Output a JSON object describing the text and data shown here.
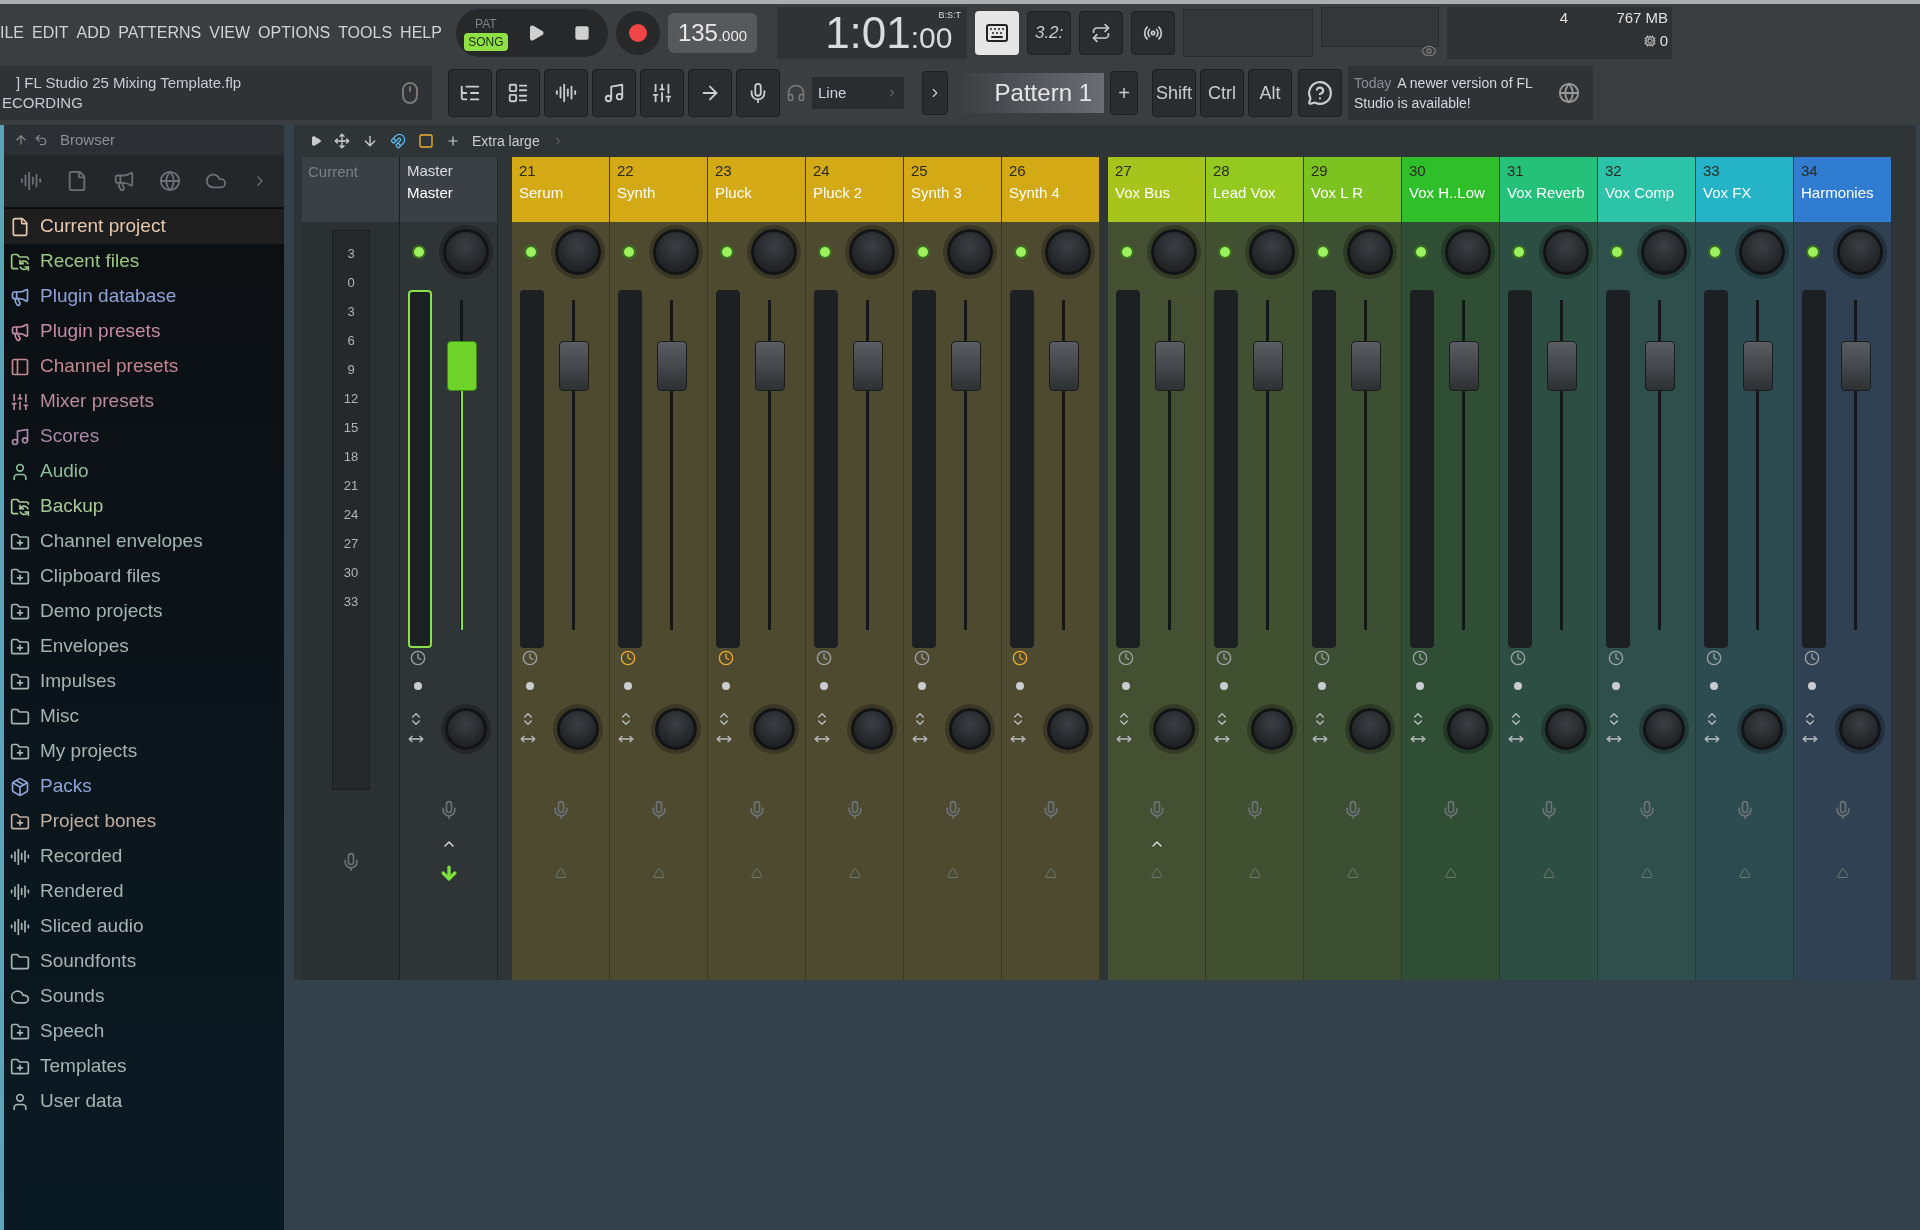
{
  "menu": [
    "ILE",
    "EDIT",
    "ADD",
    "PATTERNS",
    "VIEW",
    "OPTIONS",
    "TOOLS",
    "HELP"
  ],
  "transport": {
    "modes": [
      {
        "label": "PAT",
        "selected": false
      },
      {
        "label": "SONG",
        "selected": true
      }
    ],
    "recording": true,
    "tempo": "135",
    "tempo_fraction": ".000"
  },
  "time": {
    "main": "1:01",
    "sub": ":00",
    "format": "B:S:T"
  },
  "snap_label": "3.2:",
  "monitor": {
    "cpu": "4",
    "memory": "767 MB",
    "polyphony": "0"
  },
  "file": {
    "title": "] FL Studio 25 Mixing Template.flp",
    "status": "ECORDING"
  },
  "output": "Line",
  "pattern": {
    "name": "Pattern 1",
    "add": "+"
  },
  "modifier_keys": [
    "Shift",
    "Ctrl",
    "Alt"
  ],
  "news": {
    "when": "Today",
    "message": "A newer version of FL Studio is available!"
  },
  "browser": {
    "title": "Browser",
    "items": [
      {
        "label": "Current project",
        "kind": "file",
        "color": "#e6c8ae",
        "selected": true
      },
      {
        "label": "Recent files",
        "kind": "sync",
        "color": "#9cc685",
        "selected": false
      },
      {
        "label": "Plugin database",
        "kind": "plugin",
        "color": "#8ea4d8",
        "selected": false
      },
      {
        "label": "Plugin presets",
        "kind": "plugin",
        "color": "#c489a6",
        "selected": false
      },
      {
        "label": "Channel presets",
        "kind": "channel",
        "color": "#c48690",
        "selected": false
      },
      {
        "label": "Mixer presets",
        "kind": "mixer",
        "color": "#b98aa0",
        "selected": false
      },
      {
        "label": "Scores",
        "kind": "note",
        "color": "#a98aa8",
        "selected": false
      },
      {
        "label": "Audio",
        "kind": "user",
        "color": "#8fbc9a",
        "selected": false
      },
      {
        "label": "Backup",
        "kind": "sync",
        "color": "#a8c99a",
        "selected": false
      },
      {
        "label": "Channel envelopes",
        "kind": "folder-plus",
        "color": "#a3b5b2",
        "selected": false
      },
      {
        "label": "Clipboard files",
        "kind": "folder-plus",
        "color": "#a3b5b2",
        "selected": false
      },
      {
        "label": "Demo projects",
        "kind": "folder-plus",
        "color": "#a3b5b2",
        "selected": false
      },
      {
        "label": "Envelopes",
        "kind": "folder-plus",
        "color": "#a3b5b2",
        "selected": false
      },
      {
        "label": "Impulses",
        "kind": "folder-plus",
        "color": "#a3b5b2",
        "selected": false
      },
      {
        "label": "Misc",
        "kind": "folder",
        "color": "#a3b5b2",
        "selected": false
      },
      {
        "label": "My projects",
        "kind": "folder-plus",
        "color": "#a3b5b2",
        "selected": false
      },
      {
        "label": "Packs",
        "kind": "packs",
        "color": "#8ea4d8",
        "selected": false
      },
      {
        "label": "Project bones",
        "kind": "folder-plus",
        "color": "#c2aea0",
        "selected": false
      },
      {
        "label": "Recorded",
        "kind": "wave",
        "color": "#a3b5b2",
        "selected": false
      },
      {
        "label": "Rendered",
        "kind": "wave",
        "color": "#a3b5b2",
        "selected": false
      },
      {
        "label": "Sliced audio",
        "kind": "wave",
        "color": "#a3b5b2",
        "selected": false
      },
      {
        "label": "Soundfonts",
        "kind": "folder",
        "color": "#a3b5b2",
        "selected": false
      },
      {
        "label": "Sounds",
        "kind": "cloud",
        "color": "#a3b5b2",
        "selected": false
      },
      {
        "label": "Speech",
        "kind": "folder-plus",
        "color": "#a3b5b2",
        "selected": false
      },
      {
        "label": "Templates",
        "kind": "folder-plus",
        "color": "#a3b5b2",
        "selected": false
      },
      {
        "label": "User data",
        "kind": "user",
        "color": "#a3b5b2",
        "selected": false
      }
    ]
  },
  "mixer": {
    "size": "Extra large",
    "current_label": "Current",
    "scale": [
      "3",
      "0",
      "3",
      "6",
      "9",
      "12",
      "15",
      "18",
      "21",
      "24",
      "27",
      "30",
      "33"
    ],
    "master": {
      "number": "Master",
      "name": "Master",
      "on": true,
      "level": 0.8,
      "selected": true
    },
    "groups": [
      [
        {
          "number": "21",
          "name": "Serum",
          "color": "#d4a916",
          "on": true,
          "level": 0.8,
          "clock_on": false,
          "caret": false
        },
        {
          "number": "22",
          "name": "Synth",
          "color": "#d4a916",
          "on": true,
          "level": 0.8,
          "clock_on": true,
          "caret": false
        },
        {
          "number": "23",
          "name": "Pluck",
          "color": "#d4a916",
          "on": true,
          "level": 0.8,
          "clock_on": true,
          "caret": false
        },
        {
          "number": "24",
          "name": "Pluck 2",
          "color": "#d4a916",
          "on": true,
          "level": 0.8,
          "clock_on": false,
          "caret": false
        },
        {
          "number": "25",
          "name": "Synth 3",
          "color": "#d4a916",
          "on": true,
          "level": 0.8,
          "clock_on": false,
          "caret": false
        },
        {
          "number": "26",
          "name": "Synth 4",
          "color": "#d4a916",
          "on": true,
          "level": 0.8,
          "clock_on": true,
          "caret": false
        }
      ],
      [
        {
          "number": "27",
          "name": "Vox Bus",
          "color": "#a6c41c",
          "on": true,
          "level": 0.8,
          "clock_on": false,
          "caret": true
        },
        {
          "number": "28",
          "name": "Lead Vox",
          "color": "#94c920",
          "on": true,
          "level": 0.8,
          "clock_on": false,
          "caret": false
        },
        {
          "number": "29",
          "name": "Vox L R",
          "color": "#7cc322",
          "on": true,
          "level": 0.8,
          "clock_on": false,
          "caret": false
        },
        {
          "number": "30",
          "name": "Vox H..Low",
          "color": "#2fbf2a",
          "on": true,
          "level": 0.8,
          "clock_on": false,
          "caret": false
        },
        {
          "number": "31",
          "name": "Vox Reverb",
          "color": "#25c07a",
          "on": true,
          "level": 0.8,
          "clock_on": false,
          "caret": false
        },
        {
          "number": "32",
          "name": "Vox Comp",
          "color": "#2cc3a8",
          "on": true,
          "level": 0.8,
          "clock_on": false,
          "caret": false
        },
        {
          "number": "33",
          "name": "Vox FX",
          "color": "#25b3c8",
          "on": true,
          "level": 0.8,
          "clock_on": false,
          "caret": false
        },
        {
          "number": "34",
          "name": "Harmonies",
          "color": "#2f7cd0",
          "on": true,
          "level": 0.8,
          "clock_on": false,
          "caret": false
        }
      ]
    ]
  }
}
